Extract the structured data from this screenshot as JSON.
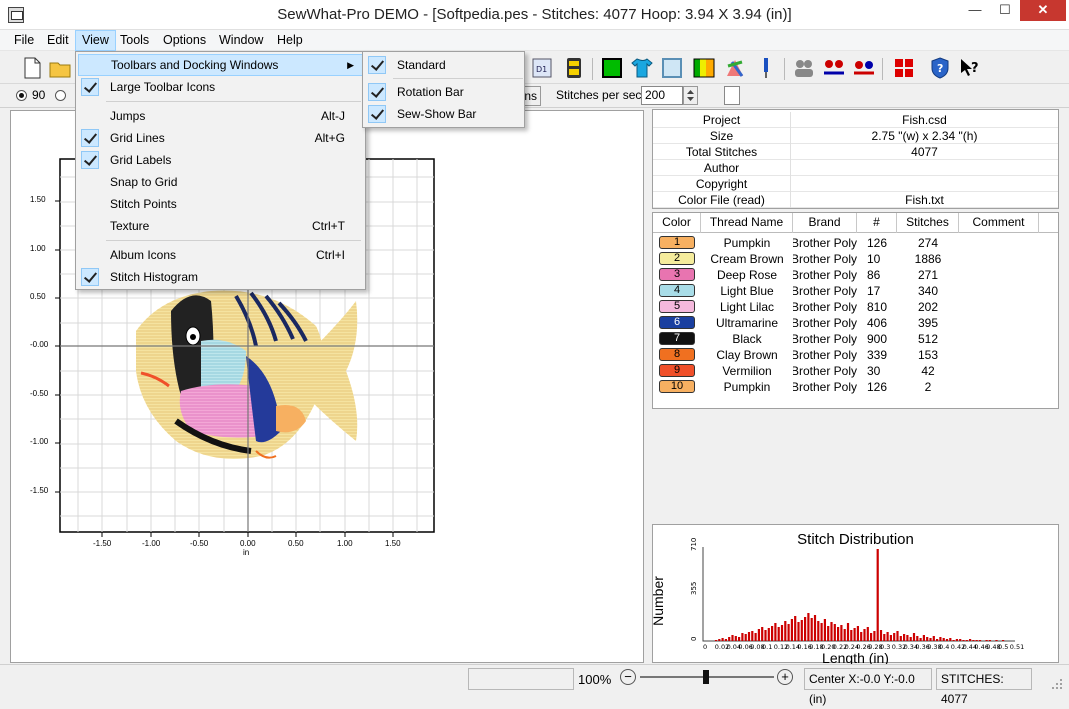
{
  "window": {
    "title": "SewWhat-Pro DEMO - [Softpedia.pes - Stitches: 4077  Hoop: 3.94 X 3.94 (in)]",
    "min": "—",
    "max": "☐",
    "close": "✕"
  },
  "menubar": [
    "File",
    "Edit",
    "View",
    "Tools",
    "Options",
    "Window",
    "Help"
  ],
  "view_menu": {
    "items": [
      {
        "label": "Toolbars and Docking Windows",
        "shortcut": "",
        "checked": false,
        "submenu": true,
        "highlight": true
      },
      {
        "label": "Large Toolbar Icons",
        "shortcut": "",
        "checked": true
      },
      {
        "sep": true
      },
      {
        "label": "Jumps",
        "shortcut": "Alt-J",
        "checked": false
      },
      {
        "label": "Grid Lines",
        "shortcut": "Alt+G",
        "checked": true
      },
      {
        "label": "Grid Labels",
        "shortcut": "",
        "checked": true
      },
      {
        "label": "Snap to Grid",
        "shortcut": "",
        "checked": false
      },
      {
        "label": "Stitch Points",
        "shortcut": "",
        "checked": false
      },
      {
        "label": "Texture",
        "shortcut": "Ctrl+T",
        "checked": false
      },
      {
        "sep": true
      },
      {
        "label": "Album Icons",
        "shortcut": "Ctrl+I",
        "checked": false
      },
      {
        "label": "Stitch Histogram",
        "shortcut": "",
        "checked": true
      }
    ]
  },
  "sub_menu": {
    "items": [
      {
        "label": "Standard",
        "checked": true
      },
      {
        "sep": true
      },
      {
        "label": "Rotation Bar",
        "checked": true
      },
      {
        "label": "Sew-Show Bar",
        "checked": true
      }
    ]
  },
  "rotation_bar": {
    "angle_90": "90",
    "btn_suffix": "ns",
    "stitches_per_sec_label": "Stitches per sec",
    "stitches_per_sec_value": "200"
  },
  "canvas": {
    "axis_unit": "in",
    "x_ticks": [
      "-1.50",
      "-1.00",
      "-0.50",
      "0.00",
      "0.50",
      "1.00",
      "1.50"
    ],
    "y_ticks": [
      "1.50",
      "1.00",
      "0.50",
      "-0.00",
      "-0.50",
      "-1.00",
      "-1.50"
    ]
  },
  "project_info": [
    {
      "label": "Project",
      "value": "Fish.csd"
    },
    {
      "label": "Size",
      "value": "2.75 \"(w) x 2.34 \"(h)"
    },
    {
      "label": "Total Stitches",
      "value": "4077"
    },
    {
      "label": "Author",
      "value": ""
    },
    {
      "label": "Copyright",
      "value": ""
    },
    {
      "label": "Color File (read)",
      "value": "Fish.txt"
    }
  ],
  "thread_table": {
    "columns": [
      "Color",
      "Thread Name",
      "Brand",
      "#",
      "Stitches",
      "Comment"
    ],
    "rows": [
      {
        "n": "1",
        "color": "#f7b061",
        "name": "Pumpkin",
        "brand": "Brother Poly",
        "num": "126",
        "stitches": "274"
      },
      {
        "n": "2",
        "color": "#f5ec9c",
        "name": "Cream Brown",
        "brand": "Brother Poly",
        "num": "10",
        "stitches": "1886"
      },
      {
        "n": "3",
        "color": "#e874b0",
        "name": "Deep Rose",
        "brand": "Brother Poly",
        "num": "86",
        "stitches": "271"
      },
      {
        "n": "4",
        "color": "#a9dde8",
        "name": "Light Blue",
        "brand": "Brother Poly",
        "num": "17",
        "stitches": "340"
      },
      {
        "n": "5",
        "color": "#f4b8dc",
        "name": "Light Lilac",
        "brand": "Brother Poly",
        "num": "810",
        "stitches": "202"
      },
      {
        "n": "6",
        "color": "#1a3fa0",
        "name": "Ultramarine",
        "brand": "Brother Poly",
        "num": "406",
        "stitches": "395"
      },
      {
        "n": "7",
        "color": "#111111",
        "name": "Black",
        "brand": "Brother Poly",
        "num": "900",
        "stitches": "512"
      },
      {
        "n": "8",
        "color": "#f07020",
        "name": "Clay Brown",
        "brand": "Brother Poly",
        "num": "339",
        "stitches": "153"
      },
      {
        "n": "9",
        "color": "#f0502a",
        "name": "Vermilion",
        "brand": "Brother Poly",
        "num": "30",
        "stitches": "42"
      },
      {
        "n": "10",
        "color": "#f7b061",
        "name": "Pumpkin",
        "brand": "Brother Poly",
        "num": "126",
        "stitches": "2"
      }
    ]
  },
  "histogram": {
    "title": "Stitch Distribution",
    "ylabel": "Number",
    "xlabel": "Length (in)",
    "y_ticks": [
      "710",
      "355",
      "0"
    ],
    "x_ticks": [
      "0",
      "0.02",
      "0.04",
      "0.06",
      "0.08",
      "0.1",
      "0.12",
      "0.14",
      "0.16",
      "0.18",
      "0.20",
      "0.22",
      "0.24",
      "0.26",
      "0.28",
      "0.3",
      "0.32",
      "0.34",
      "0.36",
      "0.38",
      "0.4",
      "0.42",
      "0.44",
      "0.46",
      "0.48",
      "0.5",
      "0.51"
    ]
  },
  "status": {
    "zoom": "100%",
    "zoom_out": "−",
    "zoom_in": "+",
    "center": "Center X:-0.0 Y:-0.0 (in)",
    "stitches": "STITCHES:  4077"
  },
  "colors": {
    "menu_highlight": "#cce8ff",
    "close_button": "#c7372f",
    "histogram_bar": "#cc0000"
  }
}
